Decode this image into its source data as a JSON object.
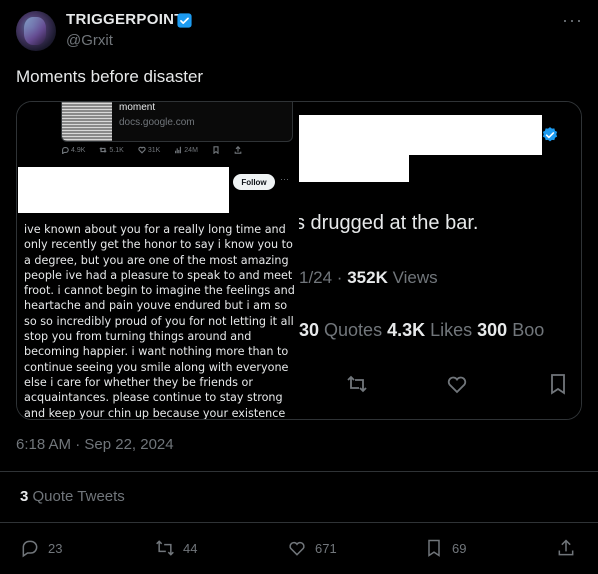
{
  "author": {
    "display_name": "TRIGGERPOINT",
    "handle": "@Grxit"
  },
  "tweet": {
    "text": "Moments before disaster",
    "timestamp": "6:18 AM · Sep 22, 2024"
  },
  "quote_tweets": {
    "count": "3",
    "label": "Quote Tweets"
  },
  "actions": {
    "replies": "23",
    "reposts": "44",
    "likes": "671",
    "bookmarks": "69"
  },
  "embedded_left": {
    "doc_title": "moment",
    "doc_url": "docs.google.com",
    "stats": {
      "replies": "4.9K",
      "reposts": "5.1K",
      "likes": "31K",
      "views": "24M"
    },
    "follow_label": "Follow",
    "more": "···",
    "body": "ive known about you for a really long time and only recently get the honor to say i know you to a degree, but you are one of the most amazing people ive had a pleasure to speak to and meet froot. i cannot begin to imagine the feelings and heartache and pain youve endured but i am so so so incredibly proud of you for not letting it all stop you from turning things around and becoming happier. i want nothing more than to continue seeing you smile along with everyone else i care for whether they be friends or acquaintances. please continue to stay strong and keep your chin up because your existence means the world to many"
  },
  "embedded_right": {
    "text_fragment": "s drugged at the bar.",
    "date_fragment": "1/24 · ",
    "views_count": "352K",
    "views_label": " Views",
    "reposts_fragment": "30",
    "quotes_label": " Quotes ",
    "likes_count": "4.3K",
    "likes_label": " Likes ",
    "bookmarks_count": "300",
    "bookmarks_label": " Boo"
  },
  "colors": {
    "background": "#000000",
    "text": "#e7e9ea",
    "muted": "#71767b",
    "verified": "#1d9bf0",
    "border": "#2f3336"
  }
}
